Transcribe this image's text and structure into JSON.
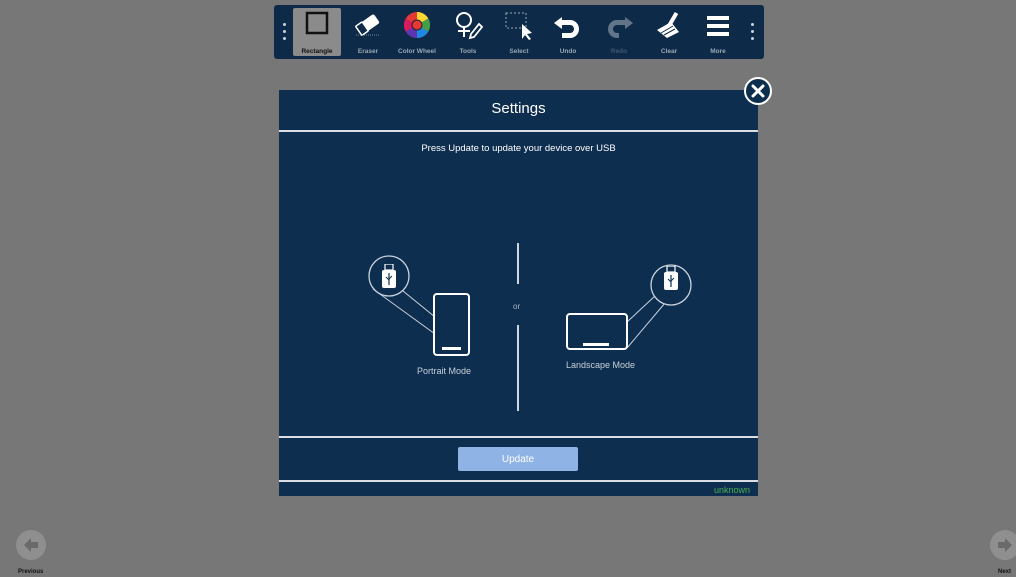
{
  "toolbar": {
    "tools": [
      {
        "label": "Rectangle",
        "icon": "rectangle-icon",
        "active": true
      },
      {
        "label": "Eraser",
        "icon": "eraser-icon"
      },
      {
        "label": "Color Wheel",
        "icon": "color-wheel-icon"
      },
      {
        "label": "Tools",
        "icon": "tools-icon"
      },
      {
        "label": "Select",
        "icon": "select-icon"
      },
      {
        "label": "Undo",
        "icon": "undo-icon"
      },
      {
        "label": "Redo",
        "icon": "redo-icon",
        "disabled": true
      },
      {
        "label": "Clear",
        "icon": "clear-icon"
      },
      {
        "label": "More",
        "icon": "menu-icon"
      }
    ]
  },
  "dialog": {
    "title": "Settings",
    "instruction": "Press Update to update your device over USB",
    "portrait_label": "Portrait Mode",
    "landscape_label": "Landscape Mode",
    "separator_label": "or",
    "update_label": "Update",
    "status": "unknown"
  },
  "nav": {
    "previous_label": "Previous",
    "next_label": "Next"
  },
  "colors": {
    "dialog_bg": "#0e2e4f",
    "toolbar_bg": "#0d2a48",
    "update_button": "#8fb3e4",
    "status_text": "#4caf50"
  }
}
